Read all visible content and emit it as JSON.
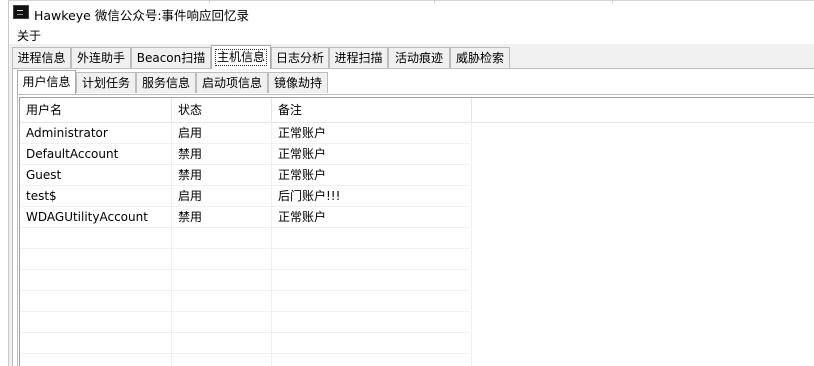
{
  "window": {
    "title": "Hawkeye 微信公众号:事件响应回忆录",
    "icon": "app-icon"
  },
  "menu": {
    "items": [
      "关于"
    ]
  },
  "main_tabs": [
    "进程信息",
    "外连助手",
    "Beacon扫描",
    "主机信息",
    "日志分析",
    "进程扫描",
    "活动痕迹",
    "威胁检索"
  ],
  "main_tabs_active": "主机信息",
  "sub_tabs": [
    "用户信息",
    "计划任务",
    "服务信息",
    "启动项信息",
    "镜像劫持"
  ],
  "sub_tabs_active": "用户信息",
  "table": {
    "columns": [
      "用户名",
      "状态",
      "备注"
    ],
    "rows": [
      [
        "Administrator",
        "启用",
        "正常账户"
      ],
      [
        "DefaultAccount",
        "禁用",
        "正常账户"
      ],
      [
        "Guest",
        "禁用",
        "正常账户"
      ],
      [
        "test$",
        "启用",
        "后门账户!!!"
      ],
      [
        "WDAGUtilityAccount",
        "禁用",
        "正常账户"
      ]
    ]
  }
}
